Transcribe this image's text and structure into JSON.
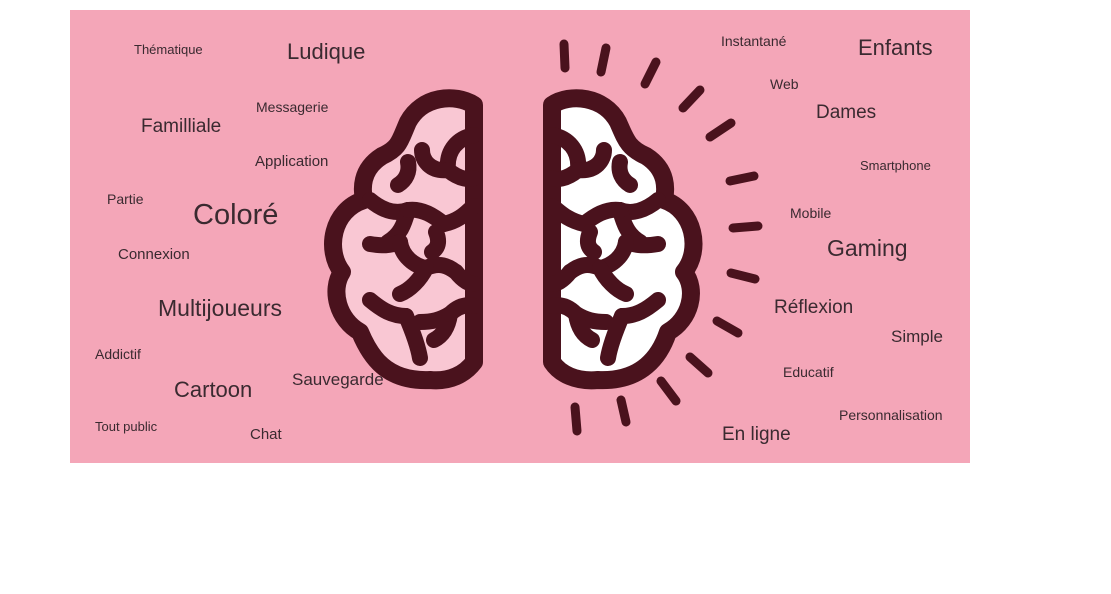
{
  "colors": {
    "background": "#f4a6b8",
    "brain_outline": "#4a121d",
    "left_hemisphere_fill": "#f9c7d3",
    "right_hemisphere_fill": "#ffffff",
    "text": "#3a2a30"
  },
  "illustration": {
    "icon": "brain-icon",
    "description_left": "left-hemisphere",
    "description_right": "right-hemisphere-with-rays"
  },
  "words": {
    "thematique": "Thématique",
    "ludique": "Ludique",
    "familliale": "Familliale",
    "messagerie": "Messagerie",
    "application": "Application",
    "partie": "Partie",
    "colore": "Coloré",
    "connexion": "Connexion",
    "multijoueurs": "Multijoueurs",
    "addictif": "Addictif",
    "cartoon": "Cartoon",
    "sauvegarde": "Sauvegarde",
    "tout_public": "Tout public",
    "chat": "Chat",
    "instantane": "Instantané",
    "enfants": "Enfants",
    "web": "Web",
    "dames": "Dames",
    "smartphone": "Smartphone",
    "mobile": "Mobile",
    "gaming": "Gaming",
    "reflexion": "Réflexion",
    "simple": "Simple",
    "educatif": "Educatif",
    "personnalisation": "Personnalisation",
    "en_ligne": "En ligne"
  }
}
